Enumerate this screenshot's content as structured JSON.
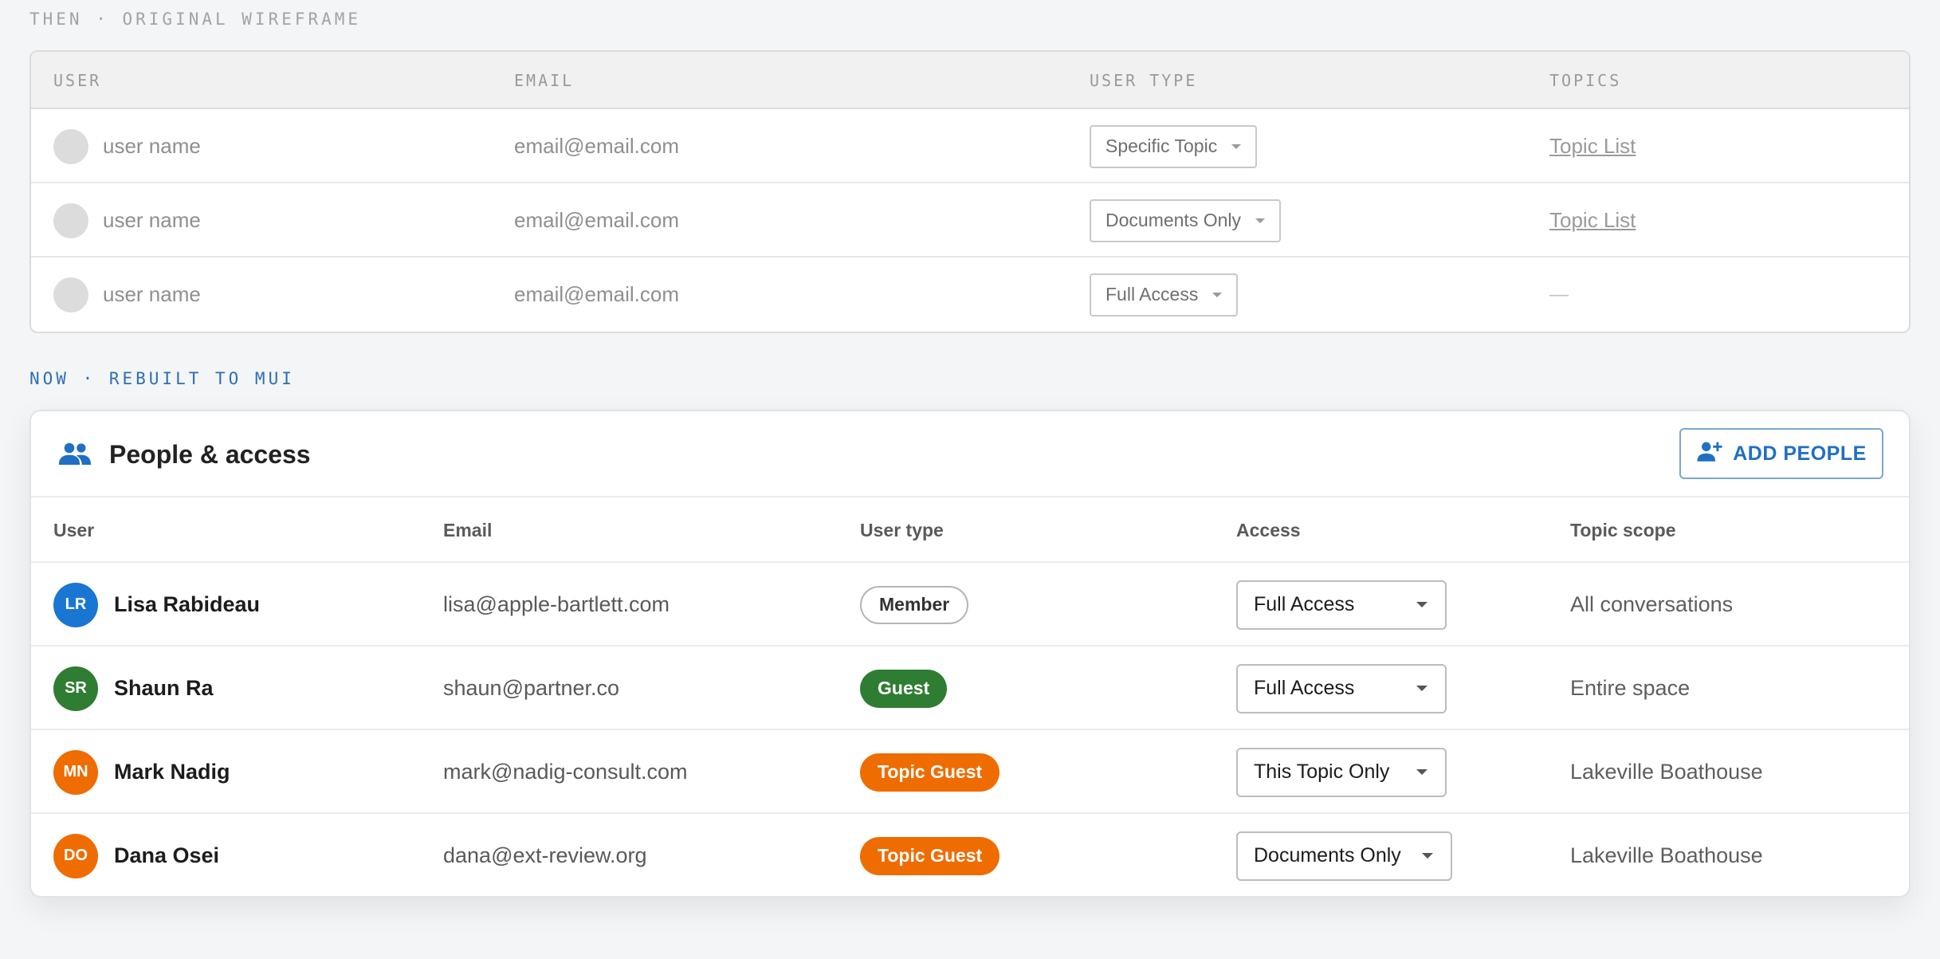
{
  "wireframe": {
    "label": "THEN · ORIGINAL WIREFRAME",
    "headers": [
      "USER",
      "EMAIL",
      "USER TYPE",
      "TOPICS"
    ],
    "rows": [
      {
        "user": "user name",
        "email": "email@email.com",
        "type": "Specific Topic",
        "topics": "Topic List"
      },
      {
        "user": "user name",
        "email": "email@email.com",
        "type": "Documents Only",
        "topics": "Topic List"
      },
      {
        "user": "user name",
        "email": "email@email.com",
        "type": "Full Access",
        "topics": "—"
      }
    ]
  },
  "rebuilt": {
    "label": "NOW · REBUILT TO MUI",
    "title": "People & access",
    "title_icon": "people-icon",
    "add_button": {
      "label": "ADD PEOPLE",
      "icon": "person-add-icon"
    },
    "headers": {
      "user": "User",
      "email": "Email",
      "user_type": "User type",
      "access": "Access",
      "scope": "Topic scope"
    },
    "rows": [
      {
        "initials": "LR",
        "avatar_color": "#1976d2",
        "name": "Lisa Rabideau",
        "email": "lisa@apple-bartlett.com",
        "user_type": "Member",
        "chip_style": "outline",
        "access": "Full Access",
        "scope": "All conversations"
      },
      {
        "initials": "SR",
        "avatar_color": "#2e7d32",
        "name": "Shaun Ra",
        "email": "shaun@partner.co",
        "user_type": "Guest",
        "chip_style": "green",
        "access": "Full Access",
        "scope": "Entire space"
      },
      {
        "initials": "MN",
        "avatar_color": "#ef6c00",
        "name": "Mark Nadig",
        "email": "mark@nadig-consult.com",
        "user_type": "Topic Guest",
        "chip_style": "orange",
        "access": "This Topic Only",
        "scope": "Lakeville Boathouse"
      },
      {
        "initials": "DO",
        "avatar_color": "#ef6c00",
        "name": "Dana Osei",
        "email": "dana@ext-review.org",
        "user_type": "Topic Guest",
        "chip_style": "orange",
        "access": "Documents Only",
        "scope": "Lakeville Boathouse"
      }
    ]
  }
}
